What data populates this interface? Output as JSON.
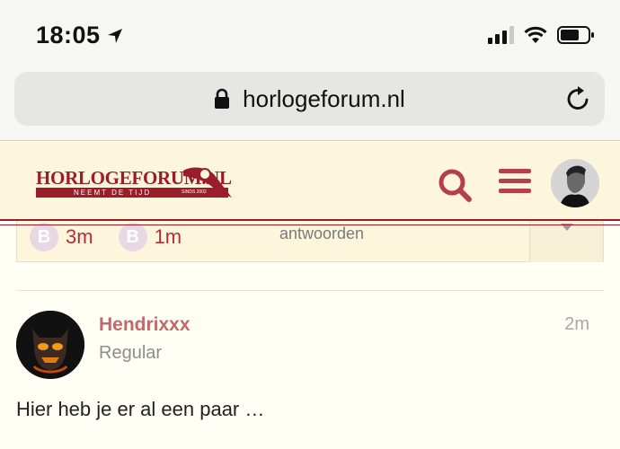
{
  "status_bar": {
    "time": "18:05",
    "location_icon": "location-arrow-icon",
    "signal_icon": "cellular-signal-icon",
    "wifi_icon": "wifi-icon",
    "battery_icon": "battery-icon"
  },
  "browser": {
    "url": "horlogeforum.nl",
    "lock_icon": "lock-icon",
    "reload_icon": "reload-icon"
  },
  "header": {
    "logo_title": "HORLOGEFORUM.NL",
    "logo_tagline": "NEEMT DE TIJD",
    "logo_since": "SINDS 2002",
    "search_icon": "search-icon",
    "menu_icon": "hamburger-menu-icon",
    "brand_color": "#9a1d2a"
  },
  "topic_map": {
    "items": [
      {
        "badge": "B",
        "value": "3m"
      },
      {
        "badge": "B",
        "value": "1m"
      }
    ],
    "replies_label": "antwoorden"
  },
  "post": {
    "username": "Hendrixxx",
    "user_title": "Regular",
    "date": "2m",
    "body": "Hier heb je er al een paar …"
  }
}
